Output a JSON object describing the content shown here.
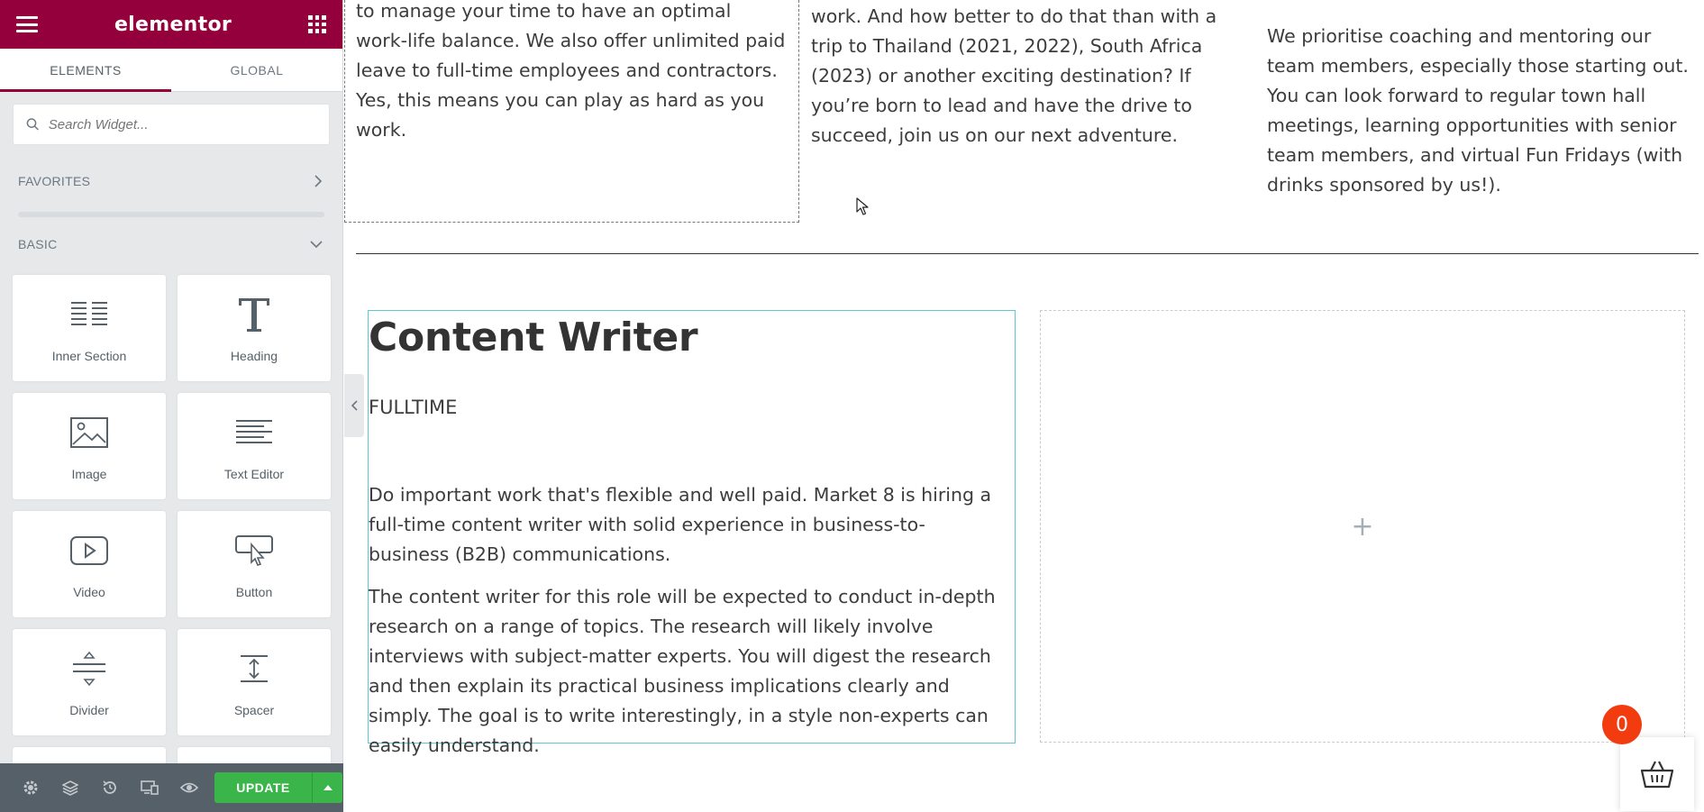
{
  "app": {
    "logo": "elementor"
  },
  "tabs": [
    {
      "label": "ELEMENTS",
      "active": true
    },
    {
      "label": "GLOBAL",
      "active": false
    }
  ],
  "search": {
    "placeholder": "Search Widget..."
  },
  "sections": {
    "favorites": "FAVORITES",
    "basic": "BASIC"
  },
  "widgets": [
    {
      "label": "Inner Section",
      "icon": "inner-section-icon"
    },
    {
      "label": "Heading",
      "icon": "heading-icon"
    },
    {
      "label": "Image",
      "icon": "image-icon"
    },
    {
      "label": "Text Editor",
      "icon": "text-editor-icon"
    },
    {
      "label": "Video",
      "icon": "video-icon"
    },
    {
      "label": "Button",
      "icon": "button-icon"
    },
    {
      "label": "Divider",
      "icon": "divider-icon"
    },
    {
      "label": "Spacer",
      "icon": "spacer-icon"
    }
  ],
  "bottombar": {
    "update_label": "UPDATE"
  },
  "canvas": {
    "col1_text": "to manage your time to have an optimal work-life balance. We also offer unlimited paid leave to full-time employees and contractors. Yes, this means you can play as hard as you work.",
    "col2_text": "work. And how better to do that than with a trip to Thailand (2021, 2022), South Africa (2023) or another exciting destination? If you’re born to lead and have the drive to succeed, join us on our next adventure.",
    "col3_text": "We prioritise coaching and mentoring our team members, especially those starting out. You can look forward to regular town hall meetings, learning opportunities with senior team members, and virtual Fun Fridays (with drinks sponsored by us!).",
    "job": {
      "title": "Content Writer",
      "type": "FULLTIME",
      "p1": "Do important work that's flexible and well paid. Market 8 is hiring a full-time content writer with solid experience in business-to-business (B2B) communications.",
      "p2": "The content writer for this role will be expected to conduct in-depth research on a range of topics. The research will likely involve interviews with subject-matter experts. You will digest the research and then explain its practical business implications clearly and simply. The goal is to write interestingly, in a style non-experts can easily understand."
    },
    "empty_column_plus": "+",
    "cart_count": "0"
  },
  "colors": {
    "brand": "#93003c",
    "update": "#39b54a",
    "badge": "#f23b0f",
    "selected_outline": "#5bc8d3"
  }
}
